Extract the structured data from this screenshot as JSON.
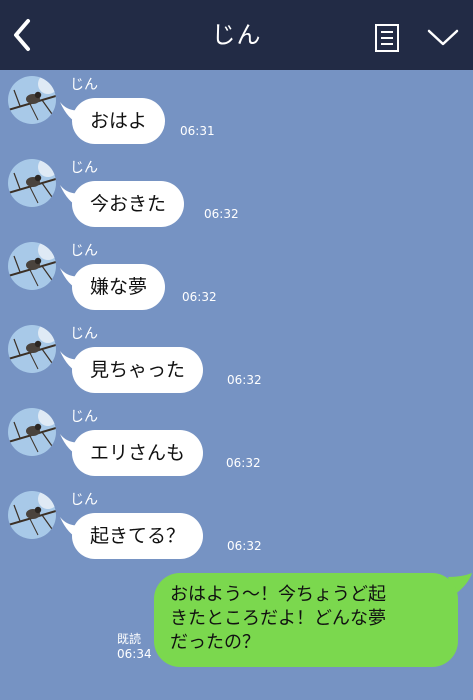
{
  "header": {
    "title": "じん",
    "back_icon": "chevron-left-icon",
    "menu_icon": "notes-icon",
    "more_icon": "chevron-down-icon"
  },
  "messages": [
    {
      "sender": "じん",
      "text": "おはよ",
      "time": "06:31"
    },
    {
      "sender": "じん",
      "text": "今おきた",
      "time": "06:32"
    },
    {
      "sender": "じん",
      "text": "嫌な夢",
      "time": "06:32"
    },
    {
      "sender": "じん",
      "text": "見ちゃった",
      "time": "06:32"
    },
    {
      "sender": "じん",
      "text": "エリさんも",
      "time": "06:32"
    },
    {
      "sender": "じん",
      "text": "起きてる？",
      "time": "06:32"
    }
  ],
  "outgoing": {
    "lines": [
      "おはよう～！今ちょうど起",
      "きたところだよ！どんな夢",
      "だったの？"
    ],
    "read_label": "既読",
    "time": "06:34"
  },
  "colors": {
    "background": "#7693c3",
    "header": "#222b45",
    "incoming_bubble": "#ffffff",
    "outgoing_bubble": "#7bd84e"
  }
}
